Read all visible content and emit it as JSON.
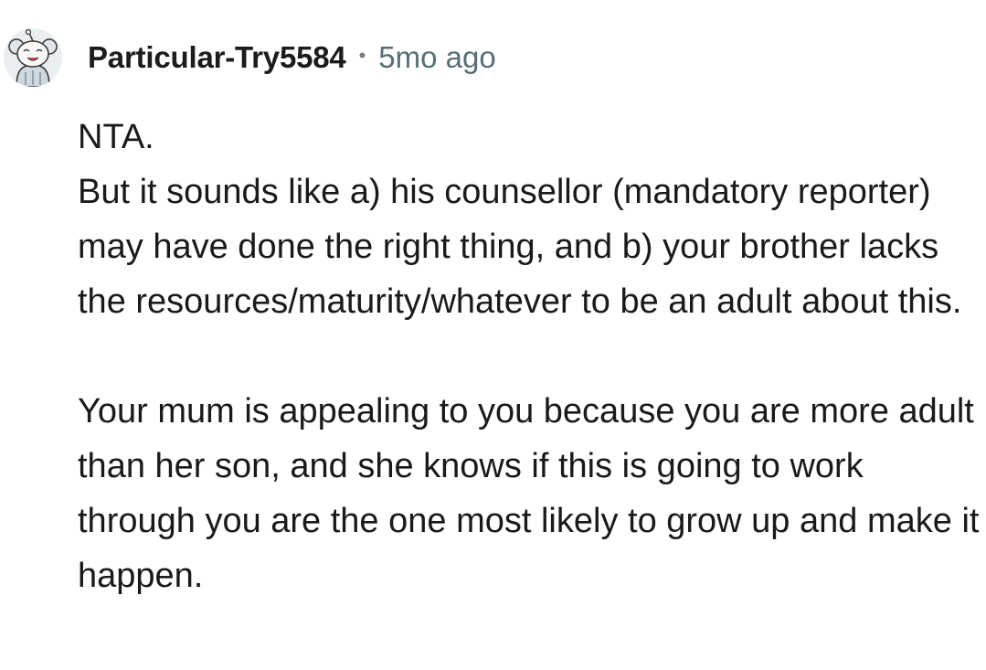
{
  "comment": {
    "author": "Particular-Try5584",
    "separator": "•",
    "age": "5mo ago",
    "avatar_icon": "snoo-avatar-icon",
    "paragraphs": [
      "NTA.",
      "But it sounds like a) his counsellor (mandatory reporter) may have done the right thing, and b) your brother lacks the resources/maturity/whatever to be an adult about this.",
      "Your mum is appealing to you because you are more adult than her son, and she knows if this is going to work through you are the one most likely to grow up and make it happen."
    ]
  }
}
